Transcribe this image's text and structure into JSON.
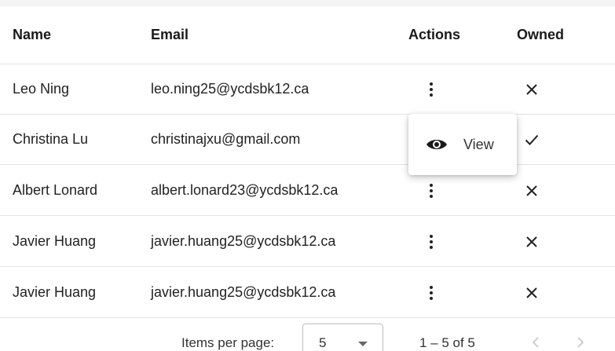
{
  "table": {
    "headers": {
      "name": "Name",
      "email": "Email",
      "actions": "Actions",
      "owned": "Owned"
    },
    "rows": [
      {
        "name": "Leo Ning",
        "email": "leo.ning25@ycdsbk12.ca",
        "owned": false,
        "owned_icon": "close-icon"
      },
      {
        "name": "Christina Lu",
        "email": "christinajxu@gmail.com",
        "owned": true,
        "owned_icon": "check-icon"
      },
      {
        "name": "Albert Lonard",
        "email": "albert.lonard23@ycdsbk12.ca",
        "owned": false,
        "owned_icon": "close-icon"
      },
      {
        "name": "Javier Huang",
        "email": "javier.huang25@ycdsbk12.ca",
        "owned": false,
        "owned_icon": "close-icon"
      },
      {
        "name": "Javier Huang",
        "email": "javier.huang25@ycdsbk12.ca",
        "owned": false,
        "owned_icon": "close-icon"
      }
    ]
  },
  "action_menu": {
    "items": [
      {
        "label": "View",
        "icon": "eye-icon"
      }
    ]
  },
  "paginator": {
    "items_per_page_label": "Items per page:",
    "page_size": "5",
    "range_label": "1 – 5 of 5",
    "prev_icon": "chevron-left-icon",
    "next_icon": "chevron-right-icon"
  }
}
